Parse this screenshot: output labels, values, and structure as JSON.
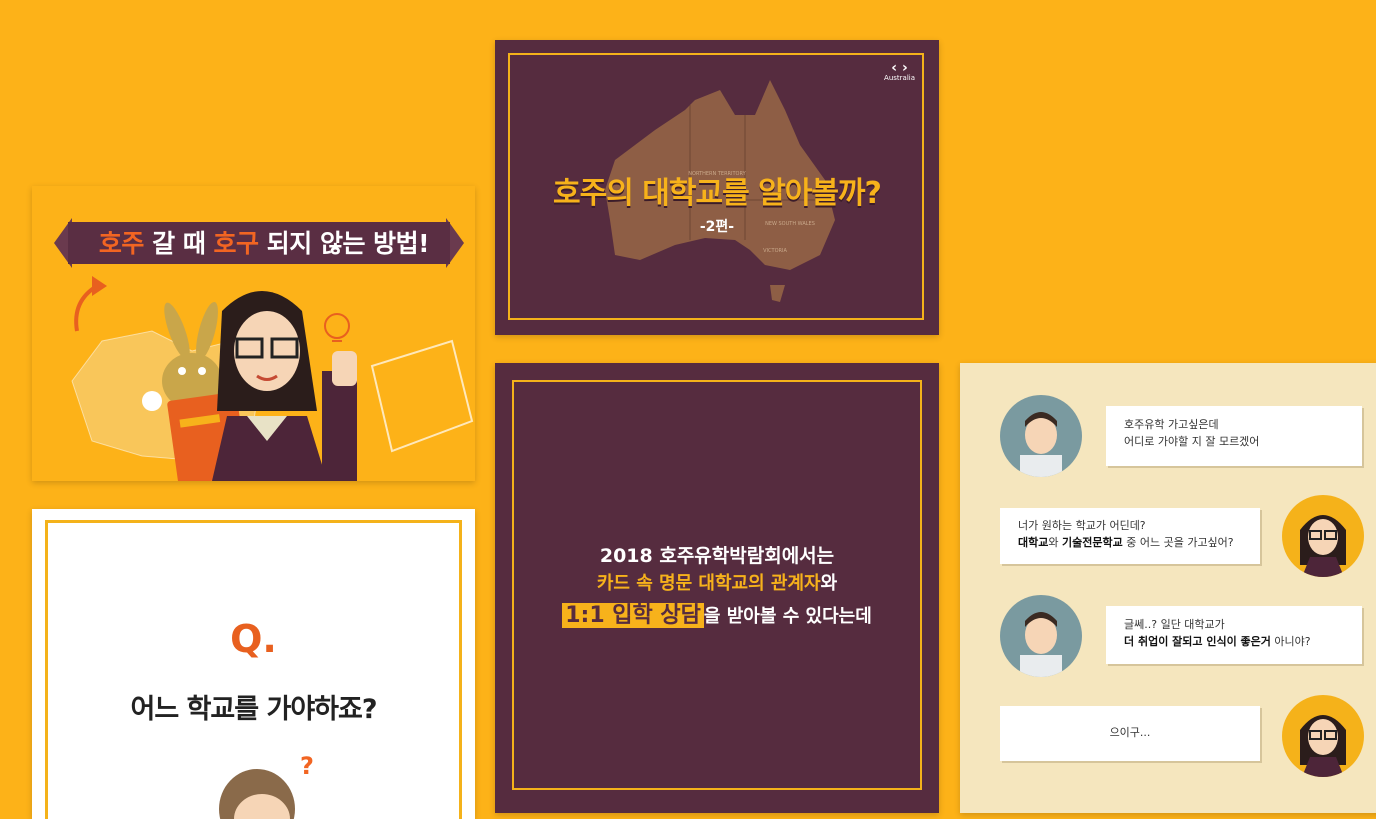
{
  "card1": {
    "ribbon": {
      "part1": "호주",
      "part2": " 갈 때 ",
      "part3": "호구",
      "part4": " 되지 않는 방법!"
    }
  },
  "card2": {
    "title": "호주의 대학교를 알아볼까?",
    "subtitle": "-2편-",
    "logo_text": "Australia",
    "map_labels": [
      "NORTHERN TERRITORY",
      "NEW SOUTH WALES",
      "VICTORIA"
    ]
  },
  "card3": {
    "q": "Q.",
    "question": "어느 학교를 가야하죠?",
    "question_mark": "?"
  },
  "card4": {
    "line1": "2018 호주유학박람회에서는",
    "line2_hl": "카드 속 명문 대학교의 관계자",
    "line2_rest": "와",
    "line3_box": "1:1 입학 상담",
    "line3_rest": "을 받아볼 수 있다는데"
  },
  "chat": {
    "b1_l1": "호주유학 가고싶은데",
    "b1_l2": "어디로 가야할 지 잘 모르겠어",
    "b2_l1": "너가 원하는 학교가 어딘데?",
    "b2_b1": "대학교",
    "b2_t1": "와 ",
    "b2_b2": "기술전문학교",
    "b2_t2": " 중 어느 곳을 가고싶어?",
    "b3_l1": "글쎄..? 일단 대학교가",
    "b3_b": "더 취업이 잘되고 인식이 좋은거",
    "b3_t": " 아니야?",
    "b4": "으이구..."
  },
  "colors": {
    "background": "#FDB218",
    "plum": "#562C3F",
    "gold": "#F7B21B",
    "orange": "#F26522",
    "cream": "#F5E6BE"
  }
}
